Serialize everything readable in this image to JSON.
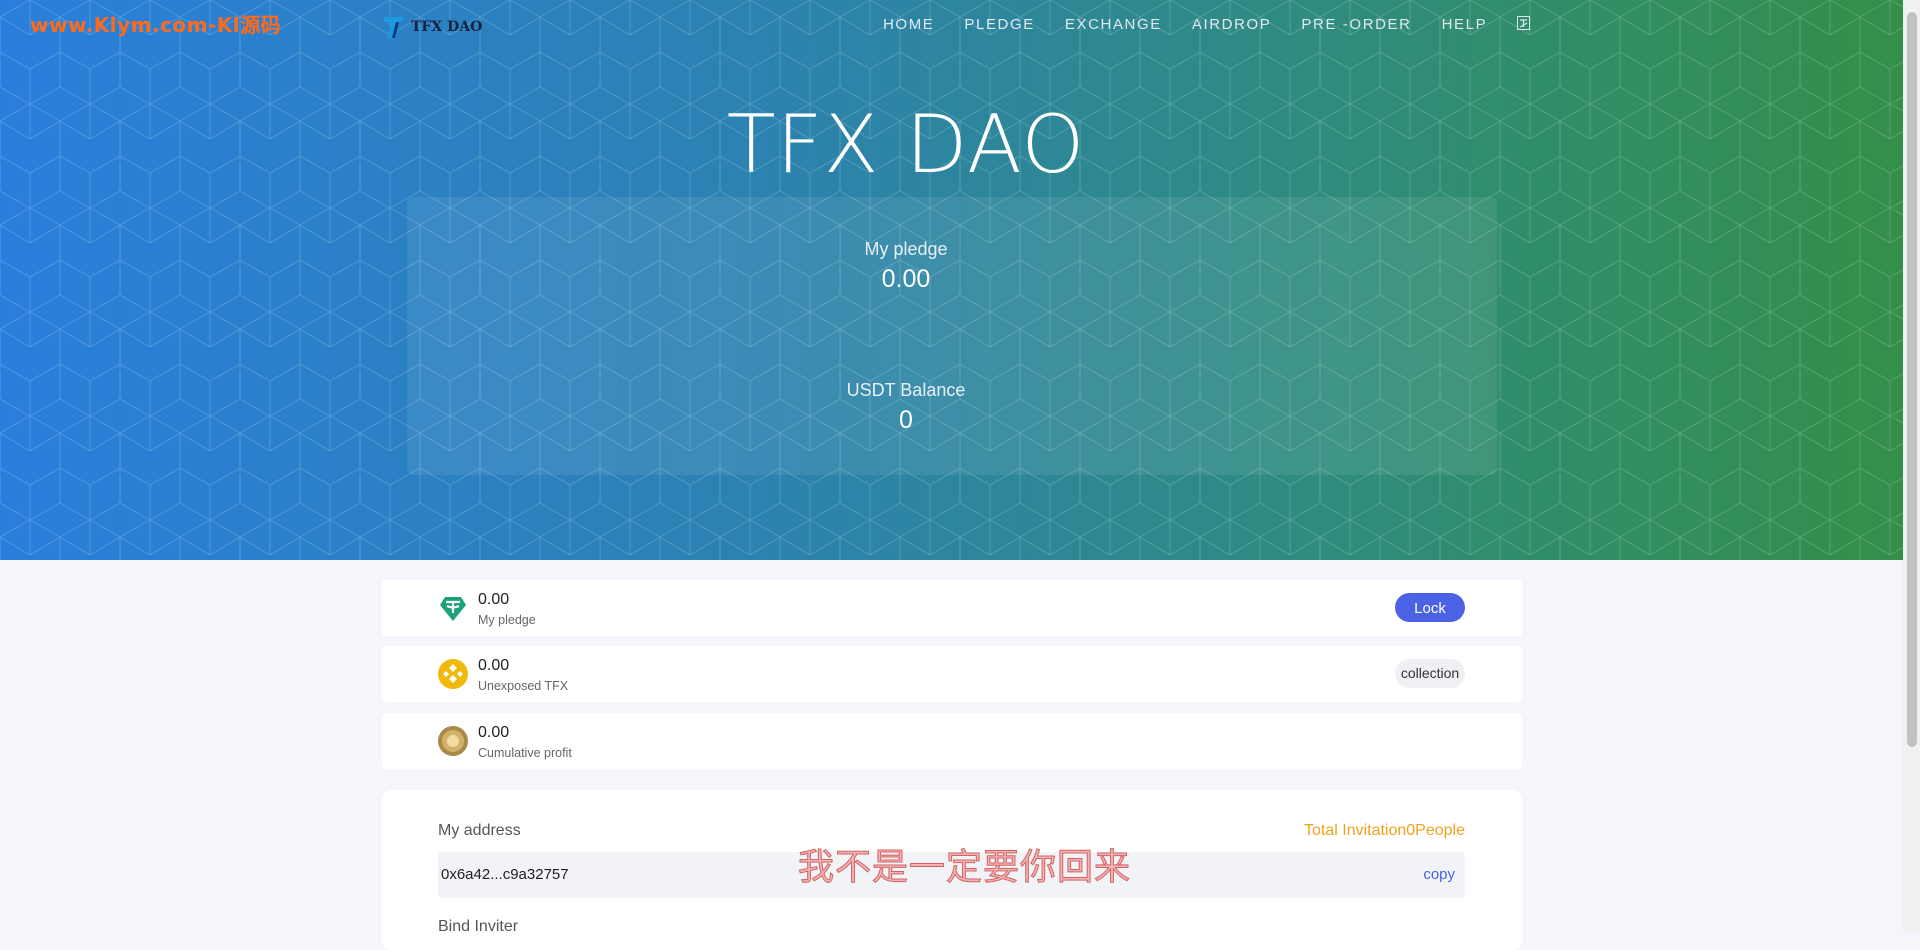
{
  "watermark": "www.Klym.com-Kl源码",
  "logo": {
    "text": "TFX DAO"
  },
  "nav": {
    "items": [
      "HOME",
      "PLEDGE",
      "EXCHANGE",
      "AIRDROP",
      "PRE -ORDER",
      "HELP"
    ],
    "language_icon": "language-icon"
  },
  "hero": {
    "title": "TFX DAO",
    "pledge_label": "My pledge",
    "pledge_value": "0.00",
    "balance_label": "USDT Balance",
    "balance_value": "0"
  },
  "rows": [
    {
      "amount": "0.00",
      "label": "My pledge",
      "icon": "tether-icon",
      "button": "Lock"
    },
    {
      "amount": "0.00",
      "label": "Unexposed TFX",
      "icon": "bnb-coin-icon",
      "button": "collection"
    },
    {
      "amount": "0.00",
      "label": "Cumulative profit",
      "icon": "gold-coin-icon"
    }
  ],
  "address": {
    "label": "My address",
    "invite_text": "Total Invitation0People",
    "value": "0x6a42...c9a32757",
    "copy_label": "copy",
    "bind_label": "Bind Inviter"
  },
  "overlay_text": "我不是一定要你回来",
  "colors": {
    "gradient_start": "#2a7fdc",
    "gradient_end": "#338f48",
    "lock_button": "#4b62e6",
    "invite_text": "#f0a21c",
    "watermark": "#ff6a1a"
  }
}
